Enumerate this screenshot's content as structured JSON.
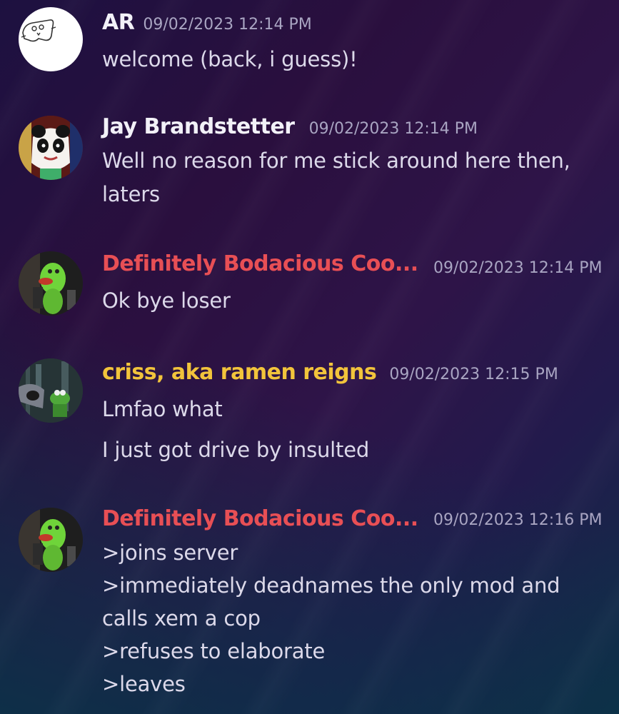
{
  "colors": {
    "default_name": "#f2f1f8",
    "red_name": "#e84f55",
    "yellow_name": "#f2c43b",
    "text": "#dcd9ea",
    "timestamp": "#a9a5c2"
  },
  "messages": [
    {
      "author": "AR",
      "timestamp": "09/02/2023 12:14 PM",
      "avatar_icon": "ghost-sketch-avatar",
      "lines": [
        "welcome (back, i guess)!"
      ]
    },
    {
      "author": "Jay Brandstetter",
      "timestamp": "09/02/2023 12:14 PM",
      "avatar_icon": "panda-character-avatar",
      "lines": [
        "Well no reason for me stick around here then,",
        "laters"
      ]
    },
    {
      "author": "Definitely Bodacious Coo...",
      "timestamp": "09/02/2023 12:14 PM",
      "avatar_icon": "slimer-ghost-avatar",
      "lines": [
        "Ok bye loser"
      ]
    },
    {
      "author": "criss, aka ramen reigns",
      "timestamp": "09/02/2023 12:15 PM",
      "avatar_icon": "kermit-city-avatar",
      "lines": [
        "Lmfao what",
        "I just got drive by insulted"
      ]
    },
    {
      "author": "Definitely Bodacious Coo...",
      "timestamp": "09/02/2023 12:16 PM",
      "avatar_icon": "slimer-ghost-avatar",
      "lines": [
        ">joins server",
        ">immediately deadnames the only mod and",
        "calls xem a cop",
        ">refuses to elaborate",
        ">leaves"
      ]
    }
  ]
}
